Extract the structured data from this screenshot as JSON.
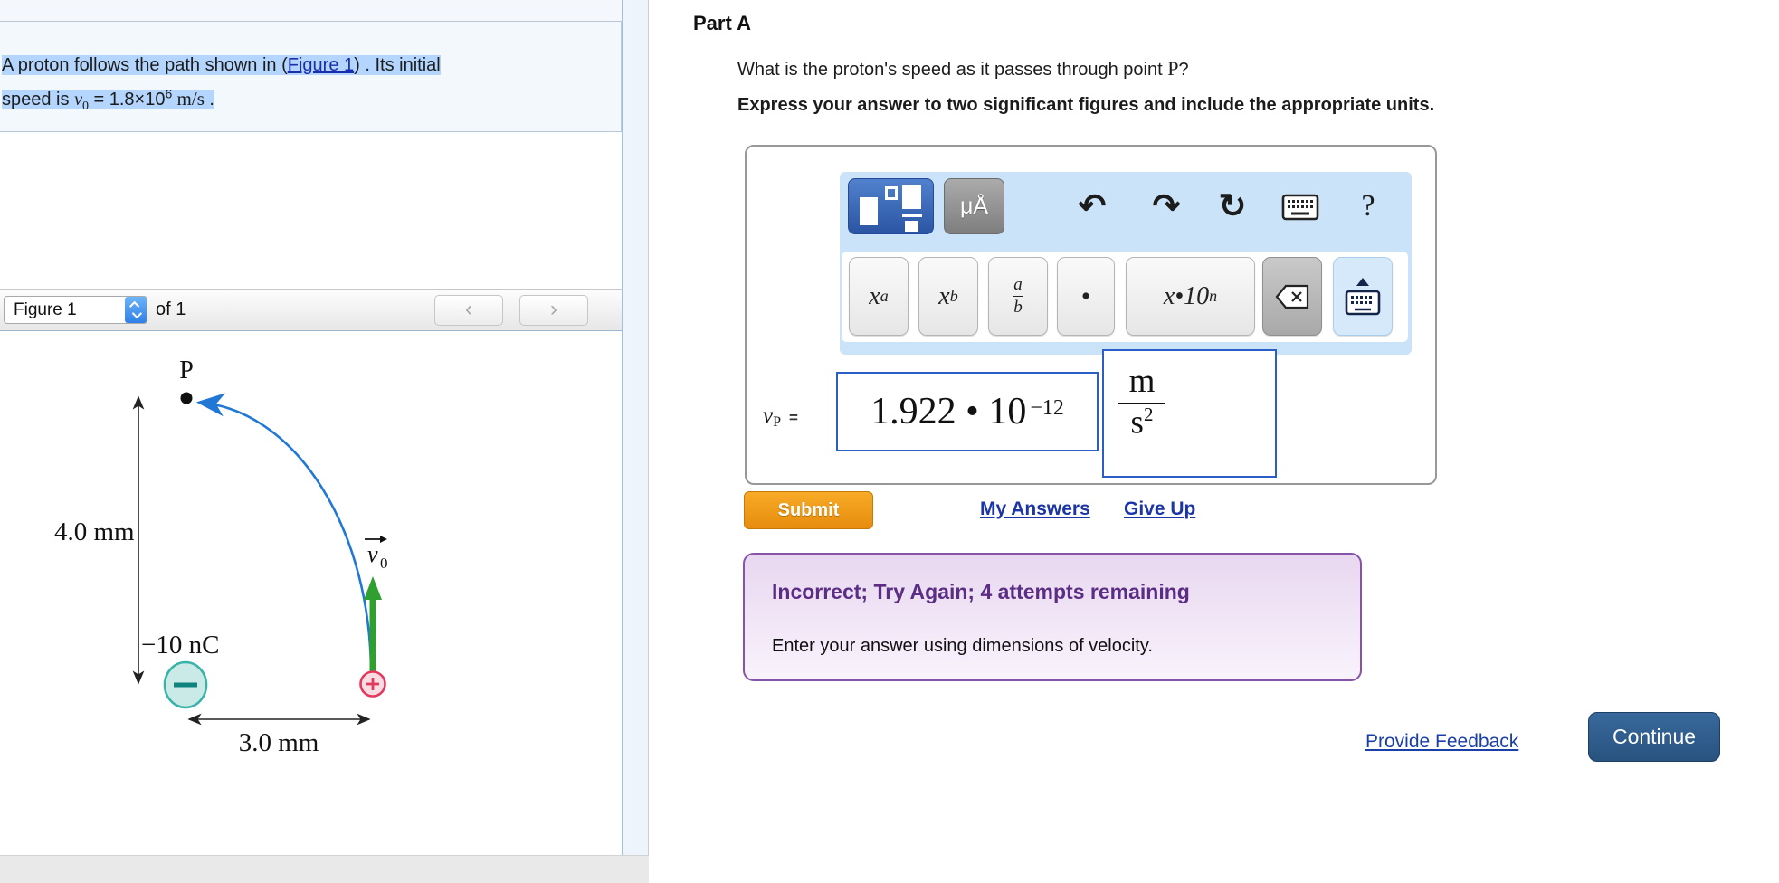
{
  "problem": {
    "line1_pre": "A proton follows the path shown in (",
    "figure_link": "Figure 1",
    "line1_post": ") . Its initial",
    "line2_pre": "speed is ",
    "v_var": "v",
    "v_sub": "0",
    "eq_value": " = 1.8×10",
    "exp": "6",
    "units": " m/s",
    "period": " ."
  },
  "figure_bar": {
    "select_value": "Figure 1",
    "of_label": "of 1",
    "prev": "‹",
    "next": "›"
  },
  "figure": {
    "point_label": "P",
    "height_label": "4.0 mm",
    "charge_label": "−10 nC",
    "width_label": "3.0 mm",
    "v0_var": "v",
    "v0_sub": "0",
    "colors": {
      "path_blue": "#2178d4",
      "velocity_green": "#2fa02f",
      "negative_fill": "#c9eae6",
      "negative_stroke": "#39b3aa",
      "positive_fill": "#fadde3",
      "positive_stroke": "#e23a5e"
    }
  },
  "part": {
    "title": "Part A",
    "question_pre": "What is the proton's speed as it passes through point ",
    "question_point": "P",
    "question_post": "?",
    "instruction": "Express your answer to two significant figures and include the appropriate units."
  },
  "editor": {
    "units_button": "μÅ",
    "help": "?",
    "undo": "↶",
    "redo": "↷",
    "reset": "↻",
    "keys": {
      "xa_base": "x",
      "xa_sup": "a",
      "xb_base": "x",
      "xb_sub": "b",
      "frac_num": "a",
      "frac_den": "b",
      "dot": "•",
      "x10_base": "x•10",
      "x10_sup": "n"
    },
    "answer": {
      "label_var": "v",
      "label_sub": "P",
      "label_eq": "=",
      "mantissa": "1.922 • 10",
      "exponent": "−12",
      "unit_num": "m",
      "unit_den": "s",
      "unit_den_exp": "2"
    }
  },
  "actions": {
    "submit": "Submit",
    "my_answers": "My Answers",
    "give_up": "Give Up"
  },
  "feedback": {
    "title": "Incorrect; Try Again; 4 attempts remaining",
    "body": "Enter your answer using dimensions of velocity."
  },
  "footer": {
    "provide_feedback": "Provide Feedback",
    "continue": "Continue"
  }
}
